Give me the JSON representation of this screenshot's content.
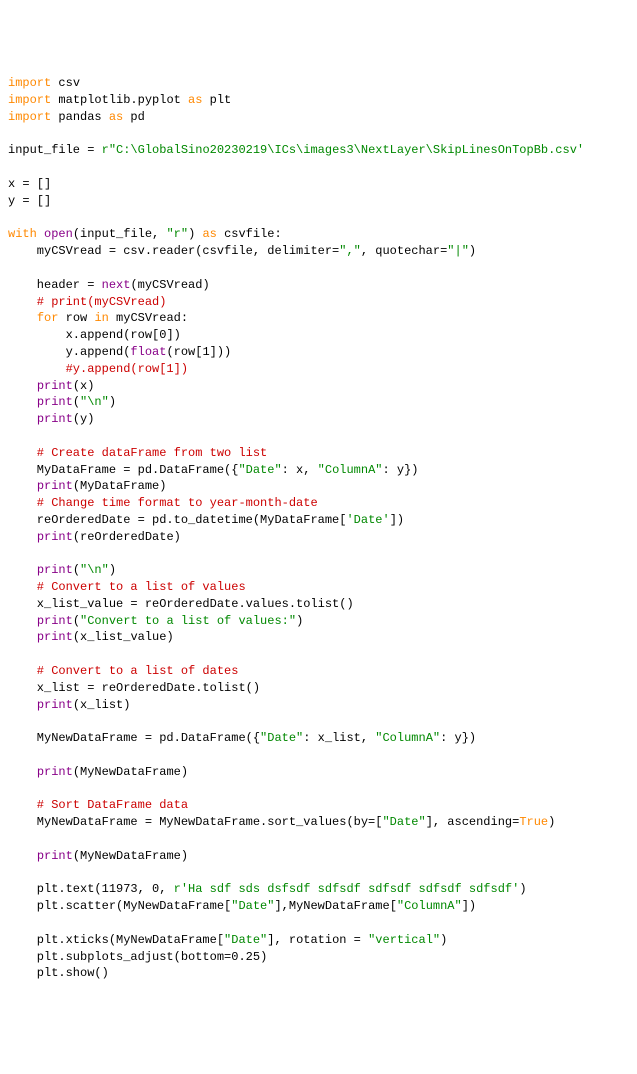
{
  "tokens": [
    {
      "t": "import",
      "c": "kw"
    },
    {
      "t": " csv\n",
      "c": "ident"
    },
    {
      "t": "import",
      "c": "kw"
    },
    {
      "t": " matplotlib.pyplot ",
      "c": "ident"
    },
    {
      "t": "as",
      "c": "kw"
    },
    {
      "t": " plt\n",
      "c": "ident"
    },
    {
      "t": "import",
      "c": "kw"
    },
    {
      "t": " pandas ",
      "c": "ident"
    },
    {
      "t": "as",
      "c": "kw"
    },
    {
      "t": " pd\n",
      "c": "ident"
    },
    {
      "t": "\n",
      "c": "ident"
    },
    {
      "t": "input_file = ",
      "c": "ident"
    },
    {
      "t": "r\"C:\\GlobalSino20230219\\ICs\\images3\\NextLayer\\SkipLinesOnTopBb.csv'",
      "c": "str"
    },
    {
      "t": "\n",
      "c": "ident"
    },
    {
      "t": "\n",
      "c": "ident"
    },
    {
      "t": "x = []\n",
      "c": "ident"
    },
    {
      "t": "y = []\n",
      "c": "ident"
    },
    {
      "t": "\n",
      "c": "ident"
    },
    {
      "t": "with",
      "c": "kw"
    },
    {
      "t": " ",
      "c": "ident"
    },
    {
      "t": "open",
      "c": "builtin"
    },
    {
      "t": "(input_file, ",
      "c": "ident"
    },
    {
      "t": "\"r\"",
      "c": "str"
    },
    {
      "t": ") ",
      "c": "ident"
    },
    {
      "t": "as",
      "c": "kw"
    },
    {
      "t": " csvfile:\n",
      "c": "ident"
    },
    {
      "t": "    myCSVread = csv.reader(csvfile, delimiter=",
      "c": "ident"
    },
    {
      "t": "\",\"",
      "c": "str"
    },
    {
      "t": ", quotechar=",
      "c": "ident"
    },
    {
      "t": "\"|\"",
      "c": "str"
    },
    {
      "t": ")\n",
      "c": "ident"
    },
    {
      "t": "\n",
      "c": "ident"
    },
    {
      "t": "    header = ",
      "c": "ident"
    },
    {
      "t": "next",
      "c": "builtin"
    },
    {
      "t": "(myCSVread)\n",
      "c": "ident"
    },
    {
      "t": "    # print(myCSVread)\n",
      "c": "comment"
    },
    {
      "t": "    ",
      "c": "ident"
    },
    {
      "t": "for",
      "c": "kw"
    },
    {
      "t": " row ",
      "c": "ident"
    },
    {
      "t": "in",
      "c": "kw"
    },
    {
      "t": " myCSVread:\n",
      "c": "ident"
    },
    {
      "t": "        x.append(row[",
      "c": "ident"
    },
    {
      "t": "0",
      "c": "ident"
    },
    {
      "t": "])\n",
      "c": "ident"
    },
    {
      "t": "        y.append(",
      "c": "ident"
    },
    {
      "t": "float",
      "c": "builtin"
    },
    {
      "t": "(row[",
      "c": "ident"
    },
    {
      "t": "1",
      "c": "ident"
    },
    {
      "t": "]))\n",
      "c": "ident"
    },
    {
      "t": "        #y.append(row[1])\n",
      "c": "comment"
    },
    {
      "t": "    ",
      "c": "ident"
    },
    {
      "t": "print",
      "c": "builtin"
    },
    {
      "t": "(x)\n",
      "c": "ident"
    },
    {
      "t": "    ",
      "c": "ident"
    },
    {
      "t": "print",
      "c": "builtin"
    },
    {
      "t": "(",
      "c": "ident"
    },
    {
      "t": "\"\\n\"",
      "c": "str"
    },
    {
      "t": ")\n",
      "c": "ident"
    },
    {
      "t": "    ",
      "c": "ident"
    },
    {
      "t": "print",
      "c": "builtin"
    },
    {
      "t": "(y)\n",
      "c": "ident"
    },
    {
      "t": "\n",
      "c": "ident"
    },
    {
      "t": "    # Create dataFrame from two list\n",
      "c": "comment"
    },
    {
      "t": "    MyDataFrame = pd.DataFrame({",
      "c": "ident"
    },
    {
      "t": "\"Date\"",
      "c": "str"
    },
    {
      "t": ": x, ",
      "c": "ident"
    },
    {
      "t": "\"ColumnA\"",
      "c": "str"
    },
    {
      "t": ": y})\n",
      "c": "ident"
    },
    {
      "t": "    ",
      "c": "ident"
    },
    {
      "t": "print",
      "c": "builtin"
    },
    {
      "t": "(MyDataFrame)\n",
      "c": "ident"
    },
    {
      "t": "    # Change time format to year-month-date\n",
      "c": "comment"
    },
    {
      "t": "    reOrderedDate = pd.to_datetime(MyDataFrame[",
      "c": "ident"
    },
    {
      "t": "'Date'",
      "c": "str"
    },
    {
      "t": "])\n",
      "c": "ident"
    },
    {
      "t": "    ",
      "c": "ident"
    },
    {
      "t": "print",
      "c": "builtin"
    },
    {
      "t": "(reOrderedDate)\n",
      "c": "ident"
    },
    {
      "t": "\n",
      "c": "ident"
    },
    {
      "t": "    ",
      "c": "ident"
    },
    {
      "t": "print",
      "c": "builtin"
    },
    {
      "t": "(",
      "c": "ident"
    },
    {
      "t": "\"\\n\"",
      "c": "str"
    },
    {
      "t": ")\n",
      "c": "ident"
    },
    {
      "t": "    # Convert to a list of values\n",
      "c": "comment"
    },
    {
      "t": "    x_list_value = reOrderedDate.values.tolist()\n",
      "c": "ident"
    },
    {
      "t": "    ",
      "c": "ident"
    },
    {
      "t": "print",
      "c": "builtin"
    },
    {
      "t": "(",
      "c": "ident"
    },
    {
      "t": "\"Convert to a list of values:\"",
      "c": "str"
    },
    {
      "t": ")\n",
      "c": "ident"
    },
    {
      "t": "    ",
      "c": "ident"
    },
    {
      "t": "print",
      "c": "builtin"
    },
    {
      "t": "(x_list_value)\n",
      "c": "ident"
    },
    {
      "t": "\n",
      "c": "ident"
    },
    {
      "t": "    # Convert to a list of dates\n",
      "c": "comment"
    },
    {
      "t": "    x_list = reOrderedDate.tolist()\n",
      "c": "ident"
    },
    {
      "t": "    ",
      "c": "ident"
    },
    {
      "t": "print",
      "c": "builtin"
    },
    {
      "t": "(x_list)\n",
      "c": "ident"
    },
    {
      "t": "\n",
      "c": "ident"
    },
    {
      "t": "    MyNewDataFrame = pd.DataFrame({",
      "c": "ident"
    },
    {
      "t": "\"Date\"",
      "c": "str"
    },
    {
      "t": ": x_list, ",
      "c": "ident"
    },
    {
      "t": "\"ColumnA\"",
      "c": "str"
    },
    {
      "t": ": y})\n",
      "c": "ident"
    },
    {
      "t": "\n",
      "c": "ident"
    },
    {
      "t": "    ",
      "c": "ident"
    },
    {
      "t": "print",
      "c": "builtin"
    },
    {
      "t": "(MyNewDataFrame)\n",
      "c": "ident"
    },
    {
      "t": "\n",
      "c": "ident"
    },
    {
      "t": "    # Sort DataFrame data\n",
      "c": "comment"
    },
    {
      "t": "    MyNewDataFrame = MyNewDataFrame.sort_values(by=[",
      "c": "ident"
    },
    {
      "t": "\"Date\"",
      "c": "str"
    },
    {
      "t": "], ascending=",
      "c": "ident"
    },
    {
      "t": "True",
      "c": "kw"
    },
    {
      "t": ")\n",
      "c": "ident"
    },
    {
      "t": "\n",
      "c": "ident"
    },
    {
      "t": "    ",
      "c": "ident"
    },
    {
      "t": "print",
      "c": "builtin"
    },
    {
      "t": "(MyNewDataFrame)\n",
      "c": "ident"
    },
    {
      "t": "\n",
      "c": "ident"
    },
    {
      "t": "    plt.text(",
      "c": "ident"
    },
    {
      "t": "11973",
      "c": "ident"
    },
    {
      "t": ", ",
      "c": "ident"
    },
    {
      "t": "0",
      "c": "ident"
    },
    {
      "t": ", ",
      "c": "ident"
    },
    {
      "t": "r'Ha sdf sds dsfsdf sdfsdf sdfsdf sdfsdf sdfsdf'",
      "c": "str"
    },
    {
      "t": ")\n",
      "c": "ident"
    },
    {
      "t": "    plt.scatter(MyNewDataFrame[",
      "c": "ident"
    },
    {
      "t": "\"Date\"",
      "c": "str"
    },
    {
      "t": "],MyNewDataFrame[",
      "c": "ident"
    },
    {
      "t": "\"ColumnA\"",
      "c": "str"
    },
    {
      "t": "])\n",
      "c": "ident"
    },
    {
      "t": "\n",
      "c": "ident"
    },
    {
      "t": "    plt.xticks(MyNewDataFrame[",
      "c": "ident"
    },
    {
      "t": "\"Date\"",
      "c": "str"
    },
    {
      "t": "], rotation = ",
      "c": "ident"
    },
    {
      "t": "\"vertical\"",
      "c": "str"
    },
    {
      "t": ")\n",
      "c": "ident"
    },
    {
      "t": "    plt.subplots_adjust(bottom=",
      "c": "ident"
    },
    {
      "t": "0.25",
      "c": "ident"
    },
    {
      "t": ")\n",
      "c": "ident"
    },
    {
      "t": "    plt.show()\n",
      "c": "ident"
    }
  ]
}
